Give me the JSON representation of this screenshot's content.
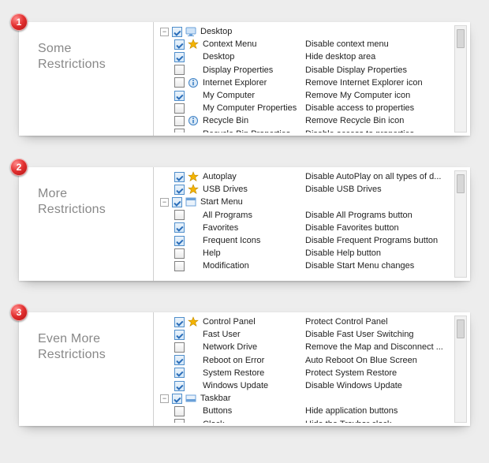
{
  "panels": [
    {
      "badge": "1",
      "title_l1": "Some",
      "title_l2": "Restrictions",
      "group": {
        "expander": "−",
        "icon": "desktop-icon",
        "label": "Desktop"
      },
      "items": [
        {
          "checked": true,
          "icon": "star-icon",
          "name": "Context Menu",
          "desc": "Disable context menu"
        },
        {
          "checked": true,
          "icon": "none",
          "name": "Desktop",
          "desc": "Hide desktop area"
        },
        {
          "checked": false,
          "icon": "none",
          "name": "Display Properties",
          "desc": "Disable Display Properties"
        },
        {
          "checked": false,
          "icon": "info-icon",
          "name": "Internet Explorer",
          "desc": "Remove Internet Explorer icon"
        },
        {
          "checked": true,
          "icon": "none",
          "name": "My Computer",
          "desc": "Remove My Computer icon"
        },
        {
          "checked": false,
          "icon": "none",
          "name": "My Computer Properties",
          "desc": "Disable access to properties"
        },
        {
          "checked": false,
          "icon": "info-icon",
          "name": "Recycle Bin",
          "desc": "Remove Recycle Bin icon"
        },
        {
          "checked": false,
          "icon": "none",
          "name": "Recycle Bin Properties",
          "desc": "Disable access to properties"
        }
      ]
    },
    {
      "badge": "2",
      "title_l1": "More",
      "title_l2": "Restrictions",
      "pre_items": [
        {
          "checked": true,
          "icon": "star-icon",
          "name": "Autoplay",
          "desc": "Disable AutoPlay on all types of d..."
        },
        {
          "checked": true,
          "icon": "star-icon",
          "name": "USB Drives",
          "desc": "Disable USB Drives"
        }
      ],
      "group": {
        "expander": "−",
        "icon": "startmenu-icon",
        "label": "Start Menu"
      },
      "items": [
        {
          "checked": false,
          "icon": "none",
          "name": "All Programs",
          "desc": "Disable All Programs button"
        },
        {
          "checked": true,
          "icon": "none",
          "name": "Favorites",
          "desc": "Disable Favorites button"
        },
        {
          "checked": true,
          "icon": "none",
          "name": "Frequent Icons",
          "desc": "Disable Frequent Programs button"
        },
        {
          "checked": false,
          "icon": "none",
          "name": "Help",
          "desc": "Disable Help button"
        },
        {
          "checked": false,
          "icon": "none",
          "name": "Modification",
          "desc": "Disable Start Menu changes"
        }
      ]
    },
    {
      "badge": "3",
      "title_l1": "Even More",
      "title_l2": "Restrictions",
      "pre_items": [
        {
          "checked": true,
          "icon": "star-icon",
          "name": "Control Panel",
          "desc": "Protect Control Panel"
        },
        {
          "checked": true,
          "icon": "none",
          "name": "Fast User",
          "desc": "Disable Fast User Switching"
        },
        {
          "checked": false,
          "icon": "none",
          "name": "Network Drive",
          "desc": "Remove the Map and Disconnect ..."
        },
        {
          "checked": true,
          "icon": "none",
          "name": "Reboot on Error",
          "desc": "Auto Reboot On Blue Screen"
        },
        {
          "checked": true,
          "icon": "none",
          "name": "System Restore",
          "desc": "Protect System Restore"
        },
        {
          "checked": true,
          "icon": "none",
          "name": "Windows Update",
          "desc": "Disable Windows Update"
        }
      ],
      "group": {
        "expander": "−",
        "icon": "taskbar-icon",
        "label": "Taskbar"
      },
      "items": [
        {
          "checked": false,
          "icon": "none",
          "name": "Buttons",
          "desc": "Hide application buttons"
        },
        {
          "checked": false,
          "icon": "none",
          "name": "Clock",
          "desc": "Hide the Traybar clock"
        }
      ]
    }
  ]
}
